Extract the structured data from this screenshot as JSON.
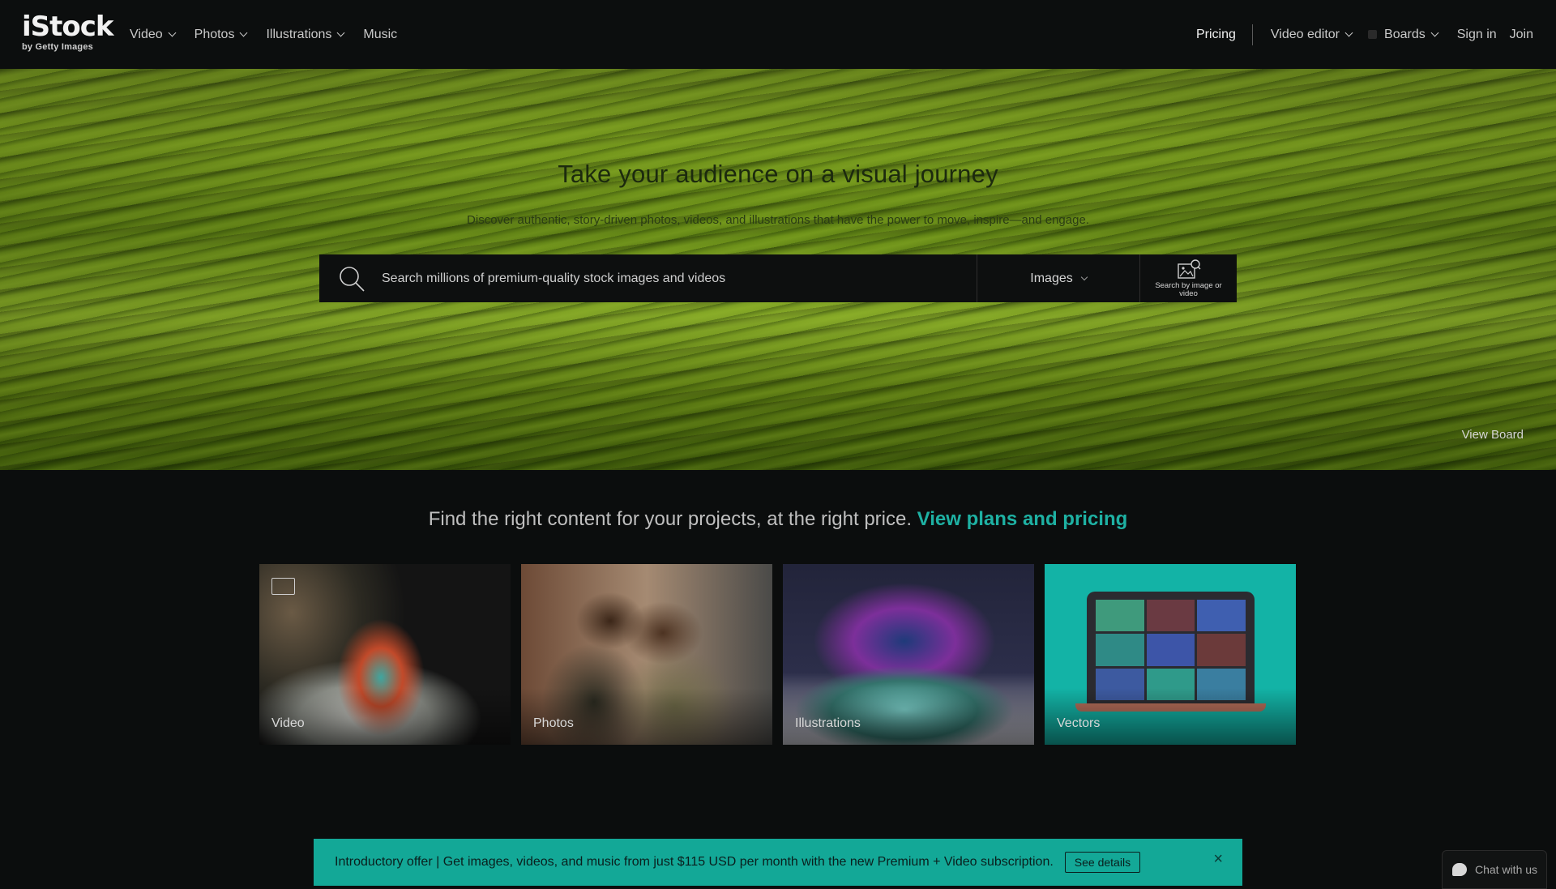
{
  "header": {
    "logo_main": "iStock",
    "logo_sub": "by Getty Images",
    "nav_left": [
      {
        "label": "Video",
        "dropdown": true
      },
      {
        "label": "Photos",
        "dropdown": true
      },
      {
        "label": "Illustrations",
        "dropdown": true
      },
      {
        "label": "Music",
        "dropdown": false
      }
    ],
    "pricing": "Pricing",
    "video_editor": "Video editor",
    "boards": "Boards",
    "sign_in": "Sign in",
    "join": "Join"
  },
  "hero": {
    "title": "Take your audience on a visual journey",
    "subtitle": "Discover authentic, story-driven photos, videos, and illustrations that have the power to move, inspire—and engage.",
    "search_placeholder": "Search millions of premium-quality stock images and videos",
    "search_type": "Images",
    "image_search_label": "Search by image or video",
    "view_board": "View Board"
  },
  "promo": {
    "text": "Find the right content for your projects, at the right price.",
    "link": "View plans and pricing"
  },
  "cards": [
    {
      "label": "Video"
    },
    {
      "label": "Photos"
    },
    {
      "label": "Illustrations"
    },
    {
      "label": "Vectors"
    }
  ],
  "offer": {
    "text": "Introductory offer | Get images, videos, and music from just $115 USD per month with the new Premium + Video subscription.",
    "button": "See details",
    "close": "×"
  },
  "chat": {
    "label": "Chat with us"
  },
  "colors": {
    "accent": "#1eb1a3",
    "banner": "#13a897",
    "background": "#0b0d0d"
  }
}
